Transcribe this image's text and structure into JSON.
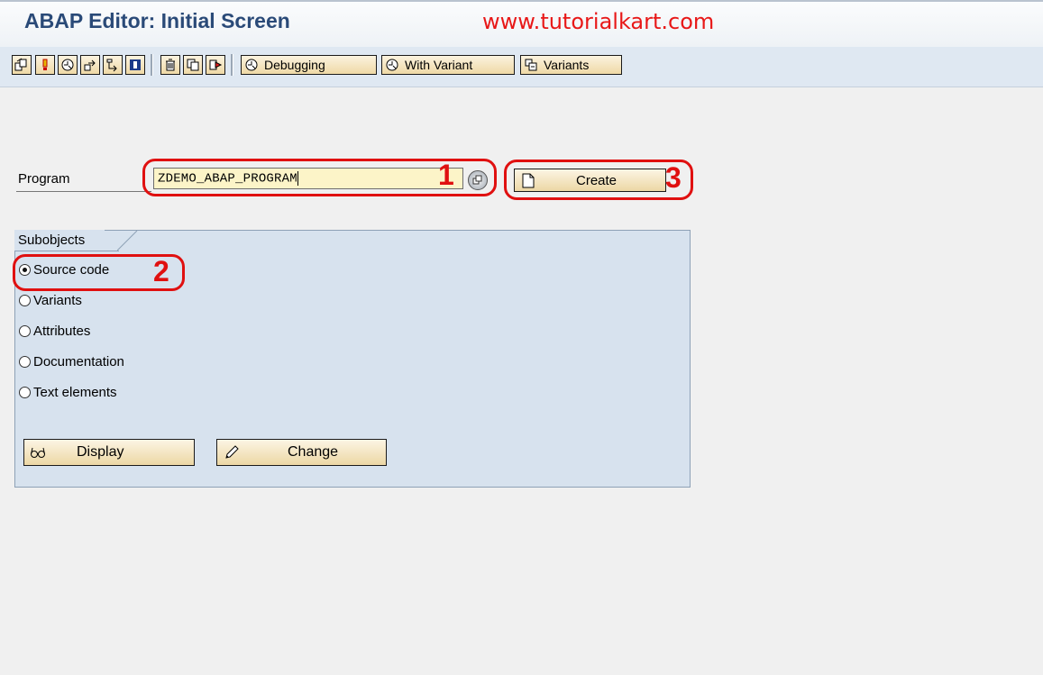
{
  "header": {
    "title": "ABAP Editor: Initial Screen",
    "watermark": "www.tutorialkart.com"
  },
  "toolbar": {
    "icon_buttons": [
      {
        "name": "other-object-icon"
      },
      {
        "name": "check-icon"
      },
      {
        "name": "activate-icon"
      },
      {
        "name": "test-execute-icon"
      },
      {
        "name": "where-used-icon"
      },
      {
        "name": "info-icon"
      },
      {
        "name": "delete-icon"
      },
      {
        "name": "copy-icon"
      },
      {
        "name": "rename-icon"
      }
    ],
    "debugging_label": "Debugging",
    "with_variant_label": "With Variant",
    "variants_label": "Variants"
  },
  "program": {
    "label": "Program",
    "value": "ZDEMO_ABAP_PROGRAM"
  },
  "create_button": {
    "label": "Create"
  },
  "subobjects": {
    "title": "Subobjects",
    "options": [
      {
        "label": "Source code",
        "selected": true
      },
      {
        "label": "Variants",
        "selected": false
      },
      {
        "label": "Attributes",
        "selected": false
      },
      {
        "label": "Documentation",
        "selected": false
      },
      {
        "label": "Text elements",
        "selected": false
      }
    ]
  },
  "actions": {
    "display_label": "Display",
    "change_label": "Change"
  },
  "annotations": {
    "one": "1",
    "two": "2",
    "three": "3",
    "color": "#e01010"
  },
  "colors": {
    "title": "#2a4a78",
    "toolbar_bg": "#dfe8f2",
    "button_bg": "#efd9a6",
    "group_bg": "#d7e2ee",
    "input_bg": "#fcf4c8"
  }
}
